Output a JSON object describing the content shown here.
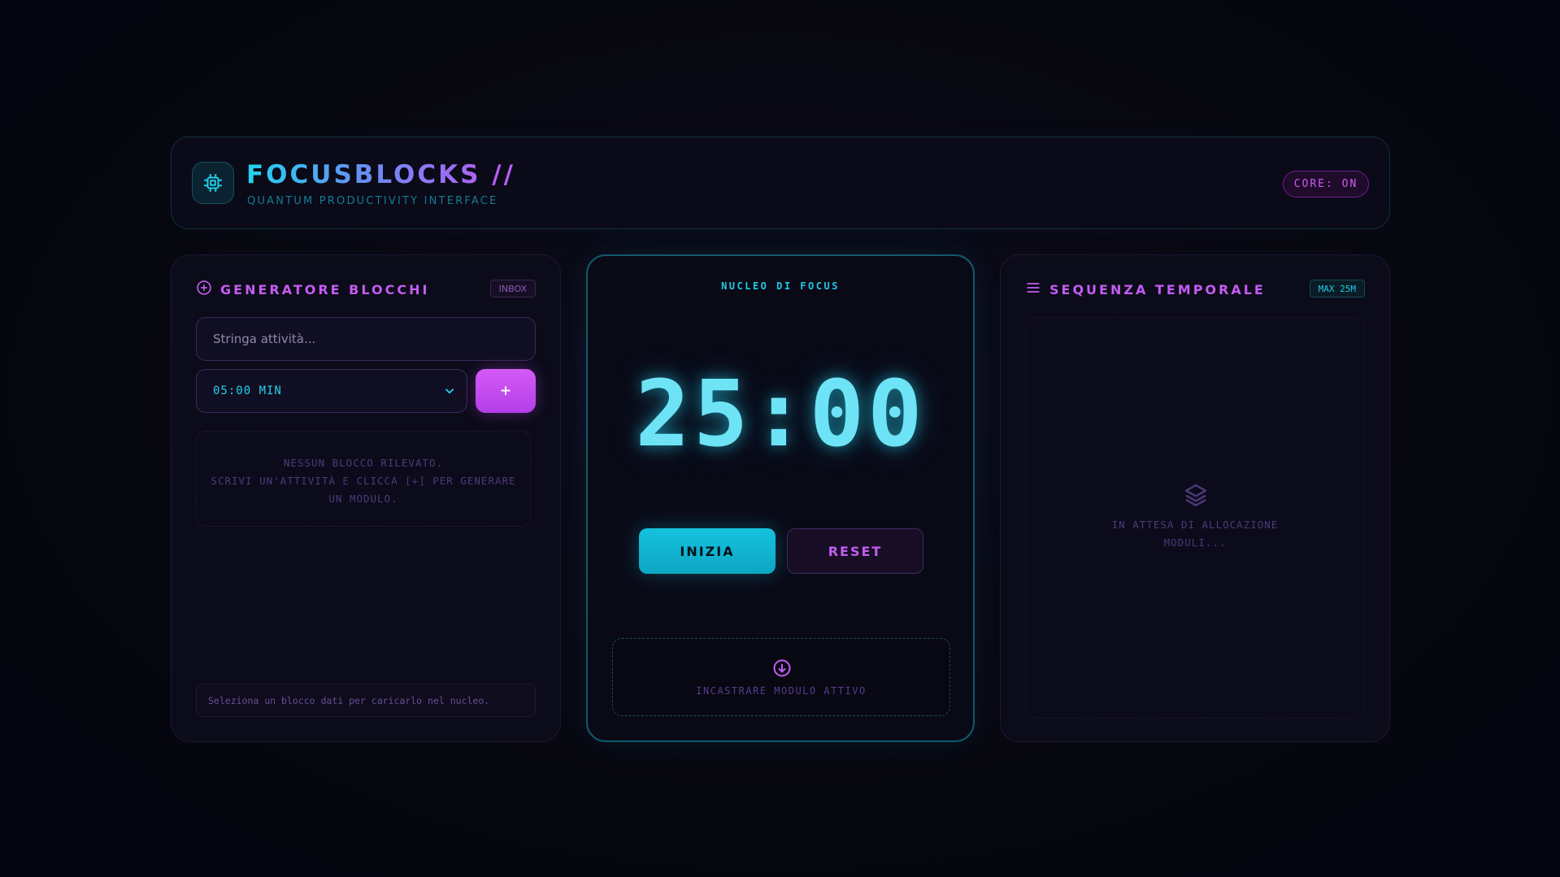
{
  "header": {
    "brand": "FOCUSBLOCKS //",
    "subtitle": "QUANTUM PRODUCTIVITY INTERFACE",
    "core_status": "CORE: ON",
    "logo_icon": "cpu-chip-icon"
  },
  "left_panel": {
    "title": "GENERATORE BLOCCHI",
    "tag": "INBOX",
    "task_placeholder": "Stringa attività...",
    "duration_value": "05:00 MIN",
    "add_label": "+",
    "empty_line1": "NESSUN BLOCCO RILEVATO.",
    "empty_line2": "SCRIVI UN'ATTIVITÀ E CLICCA [+] PER GENERARE",
    "empty_line3": "UN MODULO.",
    "footer_hint": "Seleziona un blocco dati per caricarlo nel nucleo."
  },
  "center_panel": {
    "label": "NUCLEO DI FOCUS",
    "timer": "25:00",
    "start_label": "INIZIA",
    "reset_label": "RESET",
    "drop_label": "INCASTRARE MODULO ATTIVO"
  },
  "right_panel": {
    "title": "SEQUENZA TEMPORALE",
    "tag": "MAX 25M",
    "wait_line1": "IN ATTESA DI ALLOCAZIONE",
    "wait_line2": "MODULI..."
  },
  "colors": {
    "accent_cyan": "#22d3ee",
    "accent_magenta": "#c45cf2",
    "background": "#06060f"
  }
}
